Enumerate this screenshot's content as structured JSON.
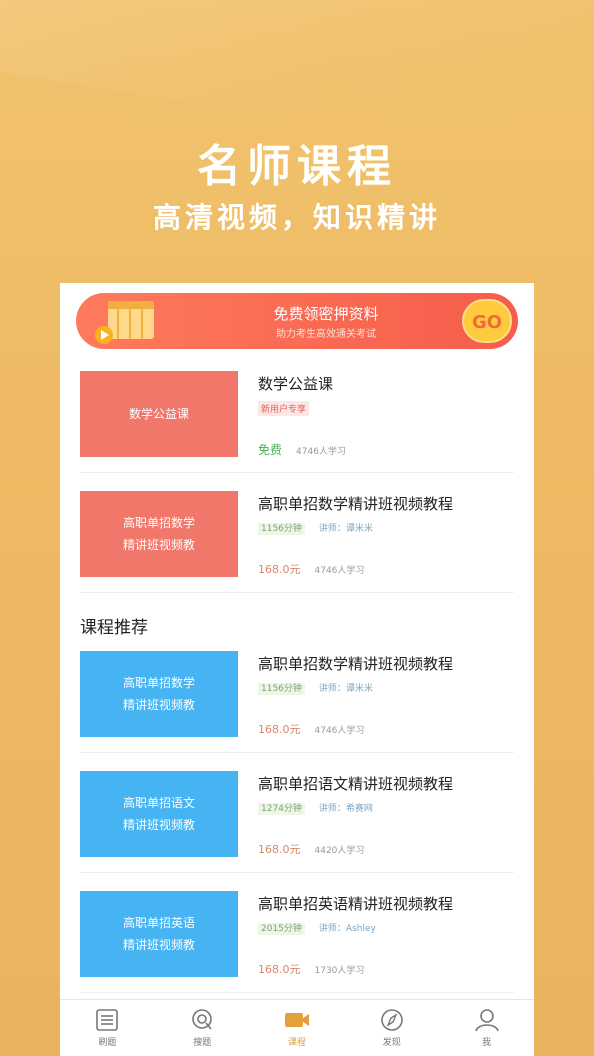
{
  "hero": {
    "title": "名师课程",
    "subtitle": "高清视频，知识精讲"
  },
  "banner": {
    "title": "免费领密押资料",
    "subtitle": "助力考生高效通关考试",
    "go_label": "GO"
  },
  "courses_top": [
    {
      "thumb_line1": "数学公益课",
      "thumb_line2": "",
      "title": "数学公益课",
      "tag": "新用户专享",
      "price": "免费",
      "learners": "4746人学习"
    },
    {
      "thumb_line1": "高职单招数学",
      "thumb_line2": "精讲班视频教",
      "title": "高职单招数学精讲班视频教程",
      "duration": "1156分钟",
      "teacher": "讲师：谭米米",
      "price": "168.0元",
      "learners": "4746人学习"
    }
  ],
  "section_title": "课程推荐",
  "courses_recommended": [
    {
      "thumb_line1": "高职单招数学",
      "thumb_line2": "精讲班视频教",
      "title": "高职单招数学精讲班视频教程",
      "duration": "1156分钟",
      "teacher": "讲师：谭米米",
      "price": "168.0元",
      "learners": "4746人学习"
    },
    {
      "thumb_line1": "高职单招语文",
      "thumb_line2": "精讲班视频教",
      "title": "高职单招语文精讲班视频教程",
      "duration": "1274分钟",
      "teacher": "讲师：希赛网",
      "price": "168.0元",
      "learners": "4420人学习"
    },
    {
      "thumb_line1": "高职单招英语",
      "thumb_line2": "精讲班视频教",
      "title": "高职单招英语精讲班视频教程",
      "duration": "2015分钟",
      "teacher": "讲师：Ashley",
      "price": "168.0元",
      "learners": "1730人学习"
    }
  ],
  "tabs": [
    {
      "label": "刷题",
      "icon": "list-icon"
    },
    {
      "label": "搜题",
      "icon": "search-icon"
    },
    {
      "label": "课程",
      "icon": "video-icon",
      "active": true
    },
    {
      "label": "发现",
      "icon": "compass-icon"
    },
    {
      "label": "我",
      "icon": "person-icon"
    }
  ],
  "colors": {
    "background": "#eeba63",
    "banner": "#f55d4b",
    "thumb_red": "#f2776b",
    "thumb_blue": "#46b4f3",
    "tab_active": "#e4a03a"
  }
}
